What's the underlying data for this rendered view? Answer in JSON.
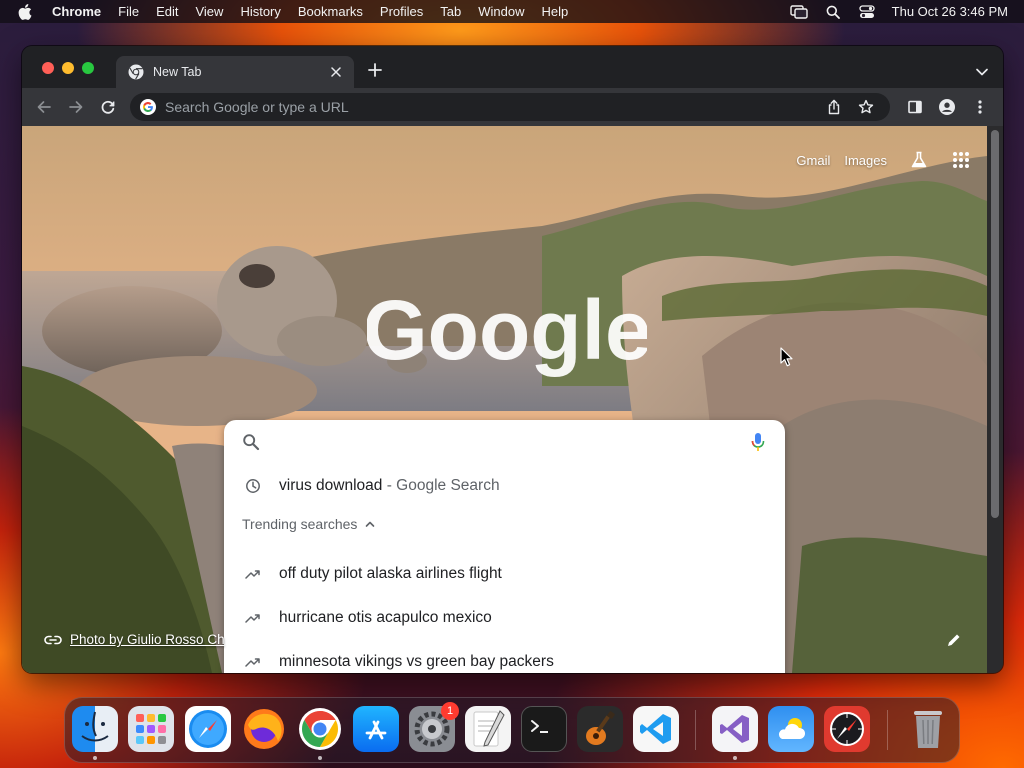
{
  "menubar": {
    "app_name": "Chrome",
    "items": [
      "File",
      "Edit",
      "View",
      "History",
      "Bookmarks",
      "Profiles",
      "Tab",
      "Window",
      "Help"
    ],
    "clock": "Thu Oct 26  3:46 PM",
    "status_icons": [
      "screen-mirroring-icon",
      "spotlight-search-icon",
      "control-center-icon"
    ]
  },
  "browser": {
    "tab": {
      "title": "New Tab",
      "favicon": "chrome-icon"
    },
    "omnibox": {
      "placeholder": "Search Google or type a URL",
      "value": ""
    }
  },
  "ntp": {
    "links": {
      "gmail": "Gmail",
      "images": "Images"
    },
    "logo_text": "Google",
    "background_attribution": "Photo by Giulio Rosso Ch",
    "search": {
      "value": "",
      "history_item": {
        "query": "virus download",
        "suffix": " - Google Search"
      },
      "trending_header": "Trending searches",
      "trending": [
        "off duty pilot alaska airlines flight",
        "hurricane otis acapulco mexico",
        "minnesota vikings vs green bay packers"
      ]
    }
  },
  "dock": {
    "apps": [
      {
        "name": "finder-icon",
        "running": true
      },
      {
        "name": "launchpad-icon",
        "running": false
      },
      {
        "name": "safari-icon",
        "running": false
      },
      {
        "name": "firefox-icon",
        "running": false
      },
      {
        "name": "chrome-icon",
        "running": true
      },
      {
        "name": "app-store-icon",
        "running": false
      },
      {
        "name": "system-settings-icon",
        "running": false,
        "badge": "1"
      },
      {
        "name": "textedit-icon",
        "running": false
      },
      {
        "name": "terminal-icon",
        "running": false
      },
      {
        "name": "garageband-icon",
        "running": false
      },
      {
        "name": "vscode-icon",
        "running": false
      },
      {
        "name": "visual-studio-icon",
        "running": true
      },
      {
        "name": "weather-icon",
        "running": false
      },
      {
        "name": "compass-icon",
        "running": false
      },
      {
        "name": "trash-icon",
        "running": false
      }
    ]
  },
  "colors": {
    "chrome_frame": "#202124",
    "chrome_toolbar": "#35363a",
    "google_blue": "#4285f4",
    "google_red": "#ea4335",
    "google_yellow": "#fbbc05",
    "google_green": "#34a853"
  }
}
